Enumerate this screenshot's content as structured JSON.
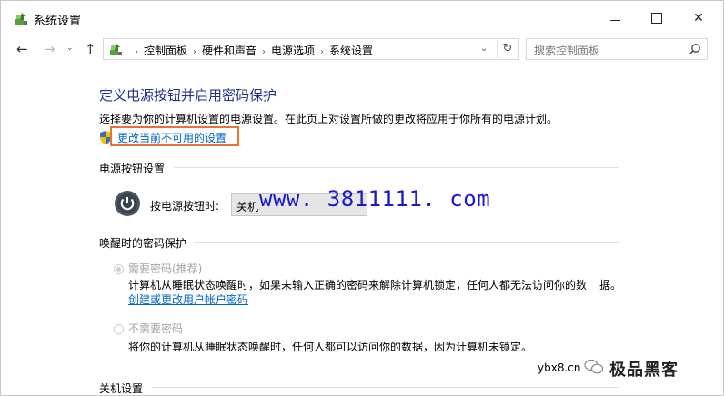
{
  "window": {
    "title": "系统设置",
    "controls": {
      "minimize": "",
      "maximize": "",
      "close": "✕"
    }
  },
  "nav": {
    "back": "←",
    "forward": "→",
    "recent": "⌄",
    "up": "↑",
    "breadcrumb": [
      "控制面板",
      "硬件和声音",
      "电源选项",
      "系统设置"
    ],
    "separator": "›",
    "dropdown": "⌄",
    "refresh": "↻",
    "search_placeholder": "搜索控制面板"
  },
  "main": {
    "title": "定义电源按钮并启用密码保护",
    "description": "选择要为你的计算机设置的电源设置。在此页上对设置所做的更改将应用于你所有的电源计划。",
    "change_link": "更改当前不可用的设置",
    "power_section": {
      "heading": "电源按钮设置",
      "label": "按电源按钮时:",
      "selected": "关机"
    },
    "wake_section": {
      "heading": "唤醒时的密码保护",
      "option_require": {
        "label": "需要密码(推荐)",
        "checked": true,
        "desc": "计算机从睡眠状态唤醒时，如果未输入正确的密码来解除计算机锁定，任何人都无法访问你的数",
        "desc2": "据。",
        "link": "创建或更改用户帐户密码"
      },
      "option_none": {
        "label": "不需要密码",
        "checked": false,
        "desc": "将你的计算机从睡眠状态唤醒时，任何人都可以访问你的数据，因为计算机未锁定。"
      }
    },
    "shutdown_section": {
      "heading": "关机设置"
    }
  },
  "overlay": {
    "watermark": "www. 3811111. com",
    "site": "ybx8.cn",
    "brand": "极品黑客"
  },
  "colors": {
    "title_blue": "#1e3287",
    "link_blue": "#0066cc",
    "highlight_orange": "#e67530",
    "watermark_blue": "#1a1acc",
    "disabled_gray": "#a5a5a5"
  }
}
